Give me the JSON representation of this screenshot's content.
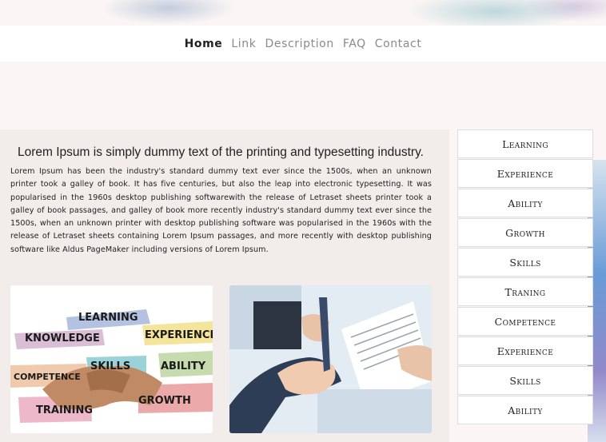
{
  "nav": {
    "items": [
      {
        "label": "Home",
        "active": true
      },
      {
        "label": "Link",
        "active": false
      },
      {
        "label": "Description",
        "active": false
      },
      {
        "label": "FAQ",
        "active": false
      },
      {
        "label": "Contact",
        "active": false
      }
    ]
  },
  "main": {
    "headline": "Lorem Ipsum is simply dummy text of the printing and typesetting industry.",
    "body": "Lorem Ipsum has been the industry's standard dummy text ever since the 1500s, when an unknown printer took a galley of book. It has five centuries, but also the leap into electronic typesetting. It was popularised in the 1960s desktop publishing softwarewith the release of Letraset sheets printer took a galley of book passages, and galley of book more recently industry's standard dummy text ever since the 1500s, when an unknown printer with desktop publishing software was popularised in the 1960s with the release of Letraset sheets containing Lorem Ipsum passages, and more recently with desktop publishing software like Aldus PageMaker including versions of Lorem Ipsum.",
    "image_left_words": [
      "LEARNING",
      "KNOWLEDGE",
      "EXPERIENCE",
      "SKILLS",
      "ABILITY",
      "COMPETENCE",
      "TRAINING",
      "GROWTH"
    ]
  },
  "sidebar": {
    "items": [
      {
        "label": "Learning"
      },
      {
        "label": "Experience"
      },
      {
        "label": "Ability"
      },
      {
        "label": "Growth"
      },
      {
        "label": "Skills"
      },
      {
        "label": "Traning"
      },
      {
        "label": "Competence"
      },
      {
        "label": "Experience"
      },
      {
        "label": "Skills"
      },
      {
        "label": "Ability"
      }
    ]
  },
  "colors": {
    "page_bg": "#fbf6f5",
    "content_bg": "#f2ecea",
    "nav_active": "#222222",
    "nav_inactive": "#8a8a8a"
  }
}
